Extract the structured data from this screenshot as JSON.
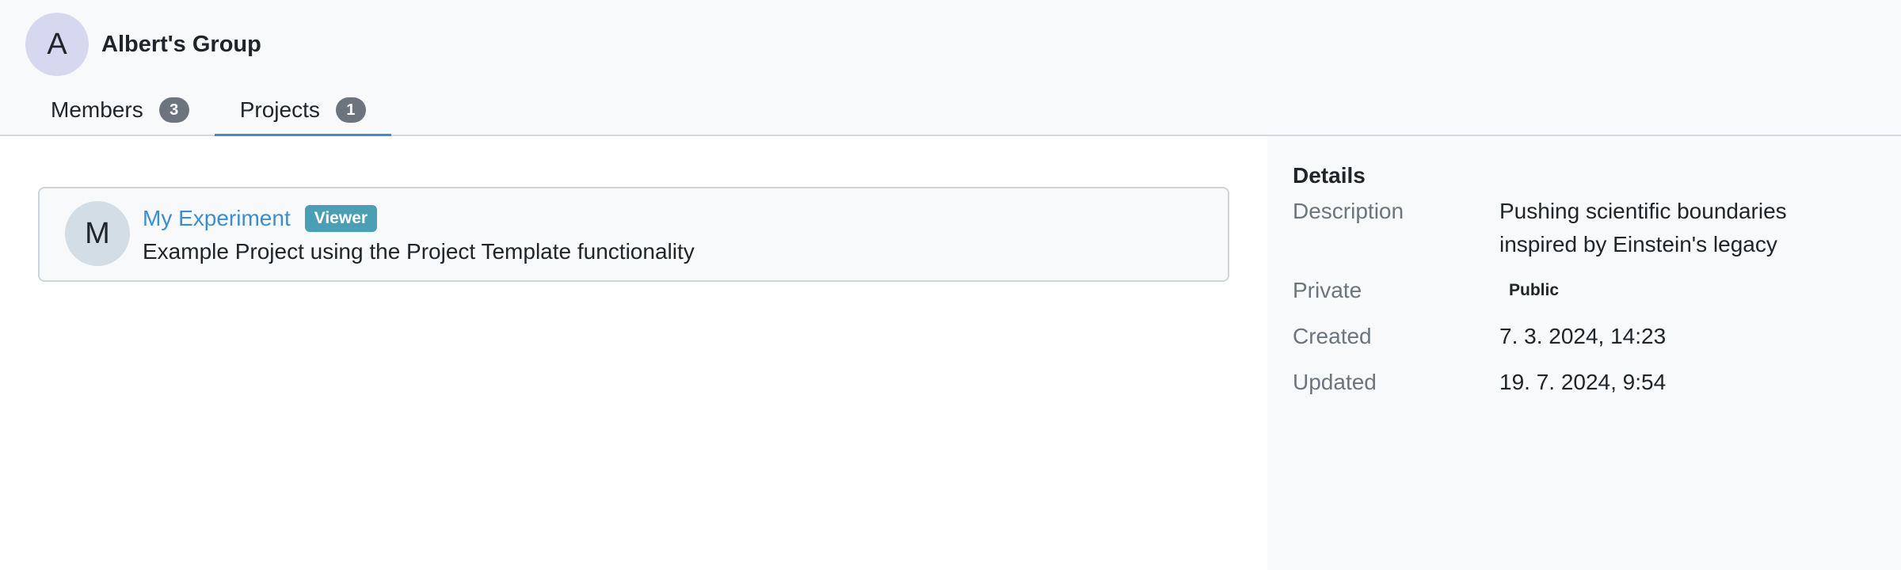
{
  "group": {
    "avatar_letter": "A",
    "title": "Albert's Group"
  },
  "tabs": [
    {
      "label": "Members",
      "count": "3",
      "active": false
    },
    {
      "label": "Projects",
      "count": "1",
      "active": true
    }
  ],
  "projects": [
    {
      "avatar_letter": "M",
      "name": "My Experiment",
      "role": "Viewer",
      "description": "Example Project using the Project Template functionality"
    }
  ],
  "details": {
    "heading": "Details",
    "description_label": "Description",
    "description_value": "Pushing scientific boundaries inspired by Einstein's legacy",
    "private_label": "Private",
    "private_value": "Public",
    "created_label": "Created",
    "created_value": "7. 3. 2024, 14:23",
    "updated_label": "Updated",
    "updated_value": "19. 7. 2024, 9:54"
  },
  "colors": {
    "accent": "#3b8fd1",
    "role_badge": "#4a9fb5",
    "count_badge": "#6c757d"
  }
}
